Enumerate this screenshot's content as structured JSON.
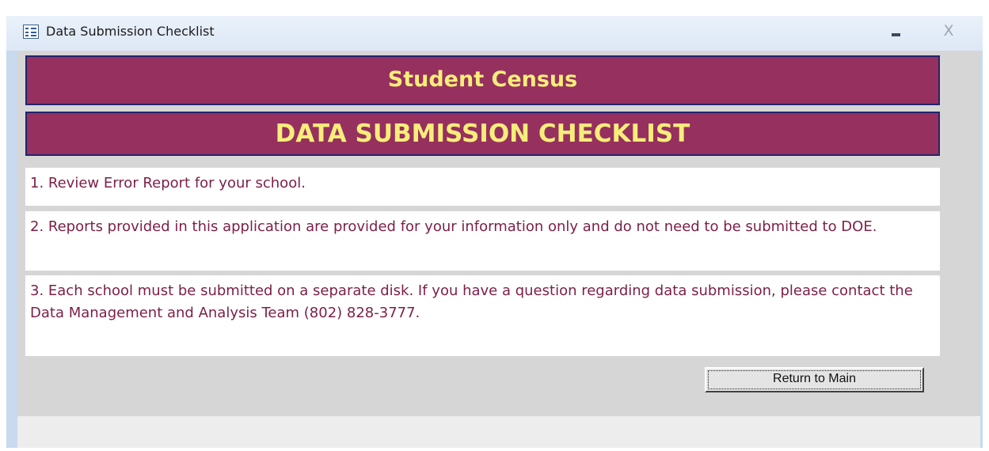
{
  "window": {
    "title": "Data Submission Checklist",
    "icon": "form-icon",
    "minimize_icon": "minimize-icon",
    "close_glyph": "X"
  },
  "form": {
    "banner_title": "Student Census",
    "banner_subtitle": "DATA SUBMISSION CHECKLIST",
    "items": [
      {
        "text": "1. Review Error Report for your school."
      },
      {
        "text": "2.  Reports provided in this application are provided for your information only and do not need to be submitted to DOE."
      },
      {
        "text": "3.  Each school must be submitted on a separate disk.  If you have a question regarding  data submission, please contact the Data Management and Analysis Team (802) 828-3777."
      }
    ],
    "return_button_label": "Return to Main"
  },
  "colors": {
    "banner_bg": "#96305f",
    "banner_text": "#f7ee7a",
    "item_text": "#7d1e46",
    "form_bg": "#d6d6d6",
    "frame": "#c9d9ee"
  }
}
